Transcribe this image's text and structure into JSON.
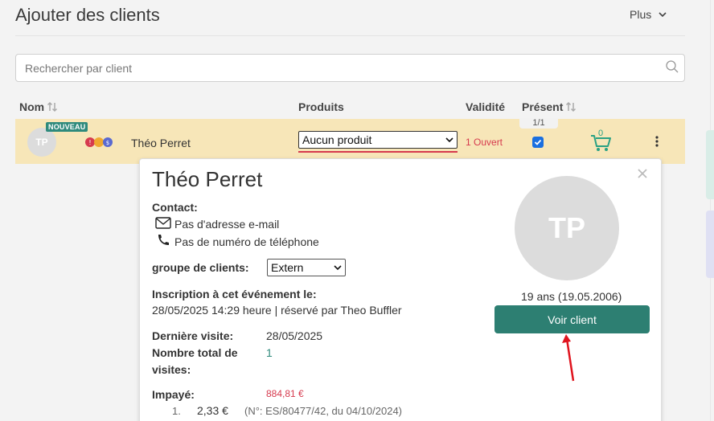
{
  "header": {
    "title": "Ajouter des clients",
    "plus_label": "Plus"
  },
  "search": {
    "placeholder": "Rechercher par client"
  },
  "columns": {
    "nom": "Nom",
    "produits": "Produits",
    "validite": "Validité",
    "present": "Présent"
  },
  "row": {
    "initials": "TP",
    "badge": "NOUVEAU",
    "name": "Théo Perret",
    "product_select": "Aucun produit",
    "validite": "1 Ouvert",
    "present_count": "1/1",
    "present_checked": true,
    "cart_count": "0",
    "status_colors": [
      "#d63a4e",
      "#f0a830",
      "#5a6ad0"
    ]
  },
  "popover": {
    "name": "Théo Perret",
    "contact_label": "Contact:",
    "email": "Pas d'adresse e-mail",
    "phone": "Pas de numéro de téléphone",
    "group_label": "groupe de clients:",
    "group_value": "Extern",
    "inscription_label": "Inscription à cet événement le:",
    "inscription_value": "28/05/2025 14:29 heure | réservé par Theo Buffler",
    "derniere_visite_label": "Dernière visite:",
    "derniere_visite_value": "28/05/2025",
    "visites_label_1": "Nombre total de",
    "visites_label_2": "visites:",
    "visites_value": "1",
    "impaye_label": "Impayé:",
    "impaye_value": "884,81 €",
    "item_index": "1.",
    "item_amount": "2,33 €",
    "item_ref": "(N°: ES/80477/42, du 04/10/2024)",
    "avatar_initials": "TP",
    "age": "19 ans (19.05.2006)",
    "voir_label": "Voir client"
  },
  "colors": {
    "accent": "#2d7f72",
    "row_bg": "#f7e6b8",
    "alert": "#d63a4e"
  }
}
